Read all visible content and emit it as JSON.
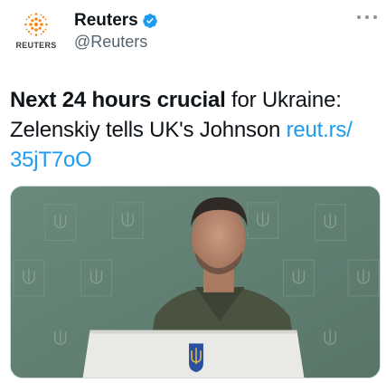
{
  "account": {
    "display_name": "Reuters",
    "handle": "@Reuters",
    "avatar_wordmark": "REUTERS",
    "verified": true
  },
  "tweet": {
    "text_bold": "Next 24 hours crucial",
    "text_line1_rest": " for Ukraine:",
    "text_line2": "Zelenskiy tells UK's Johnson ",
    "link_part1": "reut.rs/",
    "link_part2": "35jT7oO"
  },
  "media": {
    "description_icons": [
      "trident-icon"
    ],
    "colors": {
      "backdrop": "#5f7e71",
      "podium": "#e9e9e6",
      "emblem": "#2d4fa0",
      "link": "#1d9bf0"
    }
  }
}
